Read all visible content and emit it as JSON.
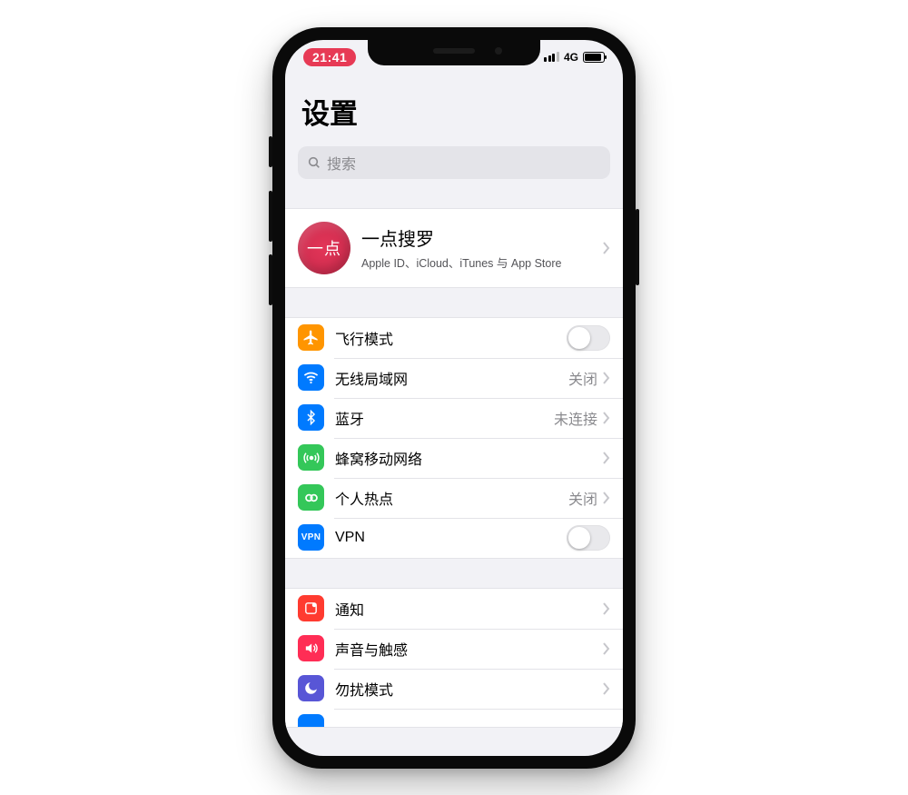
{
  "status": {
    "time": "21:41",
    "net": "4G"
  },
  "title": "设置",
  "search": {
    "placeholder": "搜索"
  },
  "profile": {
    "avatar_text": "一点",
    "name": "一点搜罗",
    "subtitle": "Apple ID、iCloud、iTunes 与 App Store"
  },
  "connectivity": {
    "airplane": {
      "label": "飞行模式"
    },
    "wifi": {
      "label": "无线局域网",
      "detail": "关闭"
    },
    "bluetooth": {
      "label": "蓝牙",
      "detail": "未连接"
    },
    "cellular": {
      "label": "蜂窝移动网络"
    },
    "hotspot": {
      "label": "个人热点",
      "detail": "关闭"
    },
    "vpn": {
      "label": "VPN"
    }
  },
  "system": {
    "notifications": {
      "label": "通知"
    },
    "sounds": {
      "label": "声音与触感"
    },
    "dnd": {
      "label": "勿扰模式"
    }
  }
}
